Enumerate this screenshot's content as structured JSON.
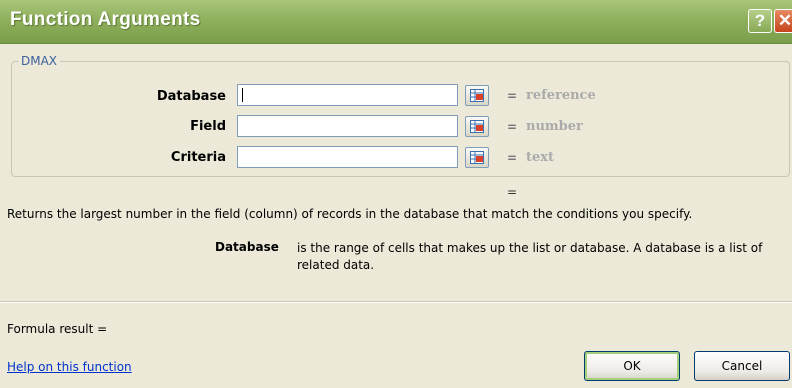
{
  "window": {
    "title": "Function Arguments",
    "help_glyph": "?",
    "close_glyph": "✕"
  },
  "function_name": "DMAX",
  "arguments": [
    {
      "label": "Database",
      "value": "",
      "equals": "=",
      "hint": "reference"
    },
    {
      "label": "Field",
      "value": "",
      "equals": "=",
      "hint": "number"
    },
    {
      "label": "Criteria",
      "value": "",
      "equals": "=",
      "hint": "text"
    }
  ],
  "result_equals": "=",
  "description": "Returns the largest number in the field (column) of records in the database that match the conditions you specify.",
  "arg_description": {
    "name": "Database",
    "text": "is the range of cells that makes up the list or database. A database is a list of related data."
  },
  "formula_result": "Formula result =",
  "help_link": "Help on this function",
  "buttons": {
    "ok": "OK",
    "cancel": "Cancel"
  },
  "icons": {
    "range_picker": "collapse-dialog-icon"
  }
}
